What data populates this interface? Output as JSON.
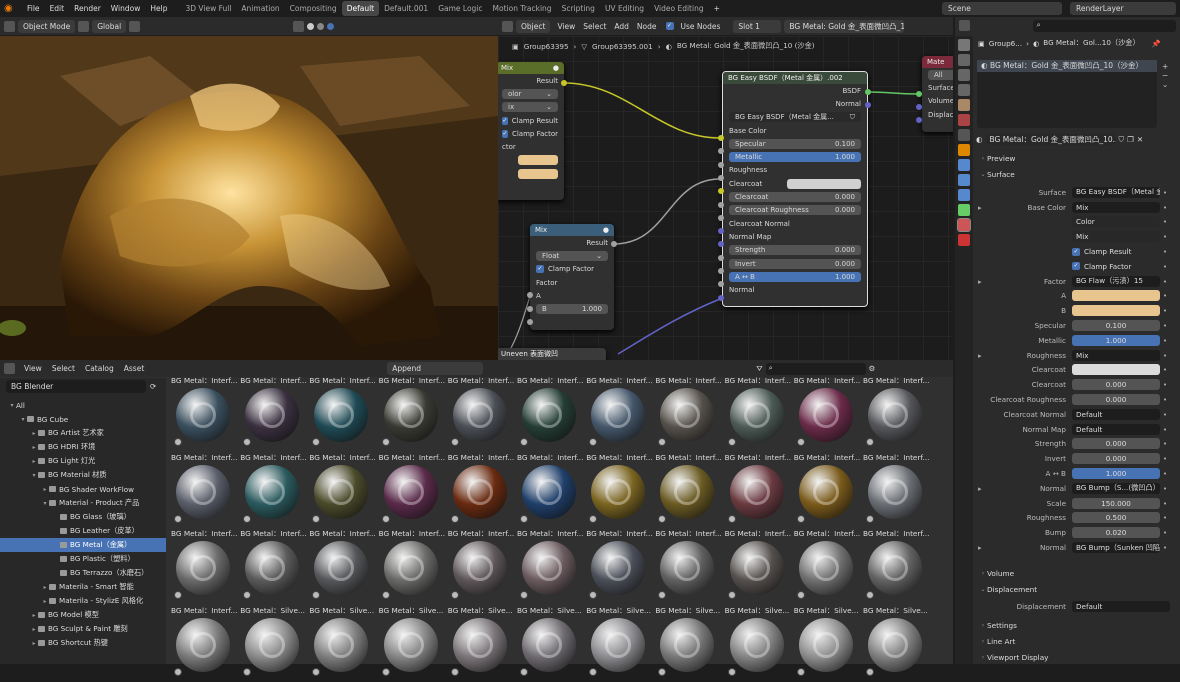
{
  "topbar": {
    "menus": [
      "File",
      "Edit",
      "Render",
      "Window",
      "Help"
    ],
    "workspaces": [
      "3D View Full",
      "Animation",
      "Compositing",
      "Default",
      "Default.001",
      "Game Logic",
      "Motion Tracking",
      "Scripting",
      "UV Editing",
      "Video Editing"
    ],
    "active_workspace": "Default",
    "add_tab": "+",
    "scene": "Scene",
    "view_layer": "RenderLayer"
  },
  "viewport_header": {
    "mode": "Object Mode",
    "orientation": "Global"
  },
  "node_header": {
    "editor_type": "Object",
    "menus": [
      "View",
      "Select",
      "Add",
      "Node"
    ],
    "use_nodes": "Use Nodes",
    "slot": "Slot 1",
    "material": "BG Metal: Gold 金_表面微凹凸_10 (沙金)"
  },
  "breadcrumb": {
    "object": "Group63395",
    "mesh": "Group63395.001",
    "material": "BG Metal: Gold 金_表面微凹凸_10 (沙金)"
  },
  "nodes": {
    "mix1": {
      "title": "Mix",
      "result": "Result",
      "color": "olor",
      "ix": "ix",
      "clamp_result": "Clamp Result",
      "clamp_factor": "Clamp Factor",
      "factor": "ctor"
    },
    "mix2": {
      "title": "Mix",
      "result": "Result",
      "type": "Float",
      "clamp_factor": "Clamp Factor",
      "factor": "Factor",
      "a": "A",
      "b_label": "B",
      "b_value": "1.000"
    },
    "bsdf": {
      "title": "BG Easy BSDF（Metal 金属）.002",
      "output": "BSDF",
      "normal_out": "Normal",
      "group": "BG Easy BSDF（Metal 金属...",
      "rows": [
        {
          "label": "Base Color",
          "type": "socket"
        },
        {
          "label": "Specular",
          "value": "0.100",
          "type": "field"
        },
        {
          "label": "Metallic",
          "value": "1.000",
          "type": "blue"
        },
        {
          "label": "Roughness",
          "type": "socket"
        },
        {
          "label": "Clearcoat",
          "type": "white"
        },
        {
          "label": "Clearcoat",
          "value": "0.000",
          "type": "field"
        },
        {
          "label": "Clearcoat Roughness",
          "value": "0.000",
          "type": "field"
        },
        {
          "label": "Clearcoat Normal",
          "type": "socket"
        },
        {
          "label": "Normal Map",
          "type": "socket"
        },
        {
          "label": "Strength",
          "value": "0.000",
          "type": "field"
        },
        {
          "label": "Invert",
          "value": "0.000",
          "type": "field"
        },
        {
          "label": "A ↔ B",
          "value": "1.000",
          "type": "blue"
        },
        {
          "label": "Normal",
          "type": "socket"
        }
      ]
    },
    "output": {
      "title": "Mate",
      "target": "All",
      "surface": "Surface",
      "volume": "Volume",
      "displacement": "Displac"
    },
    "uneven": "Uneven 表面微凹"
  },
  "asset_header": {
    "menus": [
      "View",
      "Select",
      "Catalog",
      "Asset"
    ],
    "import": "Append",
    "library": "BG Blender"
  },
  "catalog": [
    {
      "label": "All",
      "depth": 0,
      "open": true
    },
    {
      "label": "BG Cube",
      "depth": 1,
      "open": true
    },
    {
      "label": "BG Artist 艺术家",
      "depth": 2,
      "open": false
    },
    {
      "label": "BG HDRI 环境",
      "depth": 2,
      "open": false
    },
    {
      "label": "BG Light 灯光",
      "depth": 2,
      "open": false
    },
    {
      "label": "BG Material 材质",
      "depth": 2,
      "open": true
    },
    {
      "label": "BG Shader WorkFlow",
      "depth": 3,
      "open": false
    },
    {
      "label": "Material - Product 产品",
      "depth": 3,
      "open": true
    },
    {
      "label": "BG Glass（玻璃）",
      "depth": 4,
      "leaf": true
    },
    {
      "label": "BG Leather（皮革）",
      "depth": 4,
      "leaf": true
    },
    {
      "label": "BG Metal（金属）",
      "depth": 4,
      "leaf": true,
      "selected": true
    },
    {
      "label": "BG Plastic（塑料）",
      "depth": 4,
      "leaf": true
    },
    {
      "label": "BG Terrazzo（水磨石）",
      "depth": 4,
      "leaf": true
    },
    {
      "label": "Materila - Smart 智能",
      "depth": 3,
      "open": false
    },
    {
      "label": "Materila - StylizE 风格化",
      "depth": 3,
      "open": false
    },
    {
      "label": "BG Model 模型",
      "depth": 2,
      "open": false
    },
    {
      "label": "BG Sculpt & Paint 雕刻",
      "depth": 2,
      "open": false
    },
    {
      "label": "BG Shortcut 热键",
      "depth": 2,
      "open": false
    }
  ],
  "assets": {
    "rows": [
      {
        "labels": [
          "BG Metal：Interf...",
          "BG Metal：Interf...",
          "BG Metal：Interf...",
          "BG Metal：Interf...",
          "BG Metal：Interf...",
          "BG Metal：Interf...",
          "BG Metal：Interf...",
          "BG Metal：Interf...",
          "BG Metal：Interf...",
          "BG Metal：Interf...",
          "BG Metal：Interf..."
        ],
        "colors": [
          "#3a4f5e",
          "#3a3040",
          "#1f4a55",
          "#3a3a33",
          "#4a4e55",
          "#243d34",
          "#44566a",
          "#55504a",
          "#4c5a55",
          "#6a2a48",
          "#55565a"
        ]
      },
      {
        "labels": [
          "BG Metal：Interf...",
          "BG Metal：Interf...",
          "BG Metal：Interf...",
          "BG Metal：Interf...",
          "BG Metal：Interf...",
          "BG Metal：Interf...",
          "BG Metal：Interf...",
          "BG Metal：Interf...",
          "BG Metal：Interf...",
          "BG Metal：Interf...",
          "BG Metal：Interf..."
        ],
        "colors": [
          "#5a5e6a",
          "#2a5a5e",
          "#4a4a2a",
          "#5a2a4a",
          "#6a2a10",
          "#1f3f6a",
          "#7a6420",
          "#6a5a22",
          "#6a3a40",
          "#7a5a1a",
          "#6a6e74"
        ]
      },
      {
        "labels": [
          "BG Metal：Interf...",
          "BG Metal：Interf...",
          "BG Metal：Interf...",
          "BG Metal：Interf...",
          "BG Metal：Interf...",
          "BG Metal：Interf...",
          "BG Metal：Interf...",
          "BG Metal：Interf...",
          "BG Metal：Interf...",
          "BG Metal：Interf...",
          "BG Metal：Interf..."
        ],
        "colors": [
          "#6a6a6a",
          "#5a5a5a",
          "#55575a",
          "#6a6a68",
          "#5e5658",
          "#6a5a5e",
          "#4a4e58",
          "#606060",
          "#55504e",
          "#707070",
          "#626262"
        ]
      },
      {
        "labels": [
          "BG Metal：Interf...",
          "BG Metal：Silve...",
          "BG Metal：Silve...",
          "BG Metal：Silve...",
          "BG Metal：Silve...",
          "BG Metal：Silve...",
          "BG Metal：Silve...",
          "BG Metal：Silve...",
          "BG Metal：Silve...",
          "BG Metal：Silve...",
          "BG Metal：Silve..."
        ],
        "colors": [
          "#7a7a7a",
          "#8a8a8a",
          "#7e7e7e",
          "#858585",
          "#7a7478",
          "#6e6a70",
          "#8a8a8e",
          "#767676",
          "#828282",
          "#8e8e8e",
          "#808080"
        ]
      }
    ]
  },
  "properties": {
    "header_object": "Group6...",
    "header_material": "BG Metal：Gol...10（沙金）",
    "slot_item": "BG Metal：Gold 金_表面微凹凸_10（沙金）",
    "material_name": "BG Metal：Gold 金_表面微凹凸_10...",
    "sections": {
      "preview": "Preview",
      "surface": "Surface",
      "volume": "Volume",
      "displacement": "Displacement",
      "settings": "Settings",
      "line_art": "Line Art",
      "viewport_display": "Viewport Display"
    },
    "rows": [
      {
        "label": "Surface",
        "value": "BG Easy BSDF（Metal 金属...",
        "kind": "link"
      },
      {
        "label": "Base Color",
        "value": "Mix",
        "kind": "link"
      },
      {
        "label": "",
        "value": "Color",
        "kind": "dark"
      },
      {
        "label": "",
        "value": "Mix",
        "kind": "dark"
      },
      {
        "label": "",
        "value": "Clamp Result",
        "kind": "check"
      },
      {
        "label": "",
        "value": "Clamp Factor",
        "kind": "check"
      },
      {
        "label": "Factor",
        "value": "BG Flaw（污渍）15",
        "kind": "link"
      },
      {
        "label": "A",
        "value": "",
        "kind": "swatch"
      },
      {
        "label": "B",
        "value": "",
        "kind": "swatch"
      },
      {
        "label": "Specular",
        "value": "0.100",
        "kind": "field"
      },
      {
        "label": "Metallic",
        "value": "1.000",
        "kind": "blue"
      },
      {
        "label": "Roughness",
        "value": "Mix",
        "kind": "link"
      },
      {
        "label": "Clearcoat",
        "value": "",
        "kind": "white"
      },
      {
        "label": "Clearcoat",
        "value": "0.000",
        "kind": "field"
      },
      {
        "label": "Clearcoat Roughness",
        "value": "0.000",
        "kind": "field"
      },
      {
        "label": "Clearcoat Normal",
        "value": "Default",
        "kind": "link"
      },
      {
        "label": "Normal Map",
        "value": "Default",
        "kind": "link"
      },
      {
        "label": "Strength",
        "value": "0.000",
        "kind": "field"
      },
      {
        "label": "Invert",
        "value": "0.000",
        "kind": "field"
      },
      {
        "label": "A ↔ B",
        "value": "1.000",
        "kind": "blue"
      },
      {
        "label": "Normal",
        "value": "BG Bump（S...(微凹凸）.010",
        "kind": "link"
      },
      {
        "label": "Scale",
        "value": "150.000",
        "kind": "field"
      },
      {
        "label": "Roughness",
        "value": "0.500",
        "kind": "field"
      },
      {
        "label": "Bump",
        "value": "0.020",
        "kind": "field"
      },
      {
        "label": "Normal",
        "value": "BG Bump（Sunken 凹陷）.01",
        "kind": "link"
      }
    ],
    "displacement_row": {
      "label": "Displacement",
      "value": "Default"
    }
  },
  "colors": {
    "accent": "#4772b3",
    "swatch": "#e8c48e",
    "header": "#2b2b2b"
  }
}
